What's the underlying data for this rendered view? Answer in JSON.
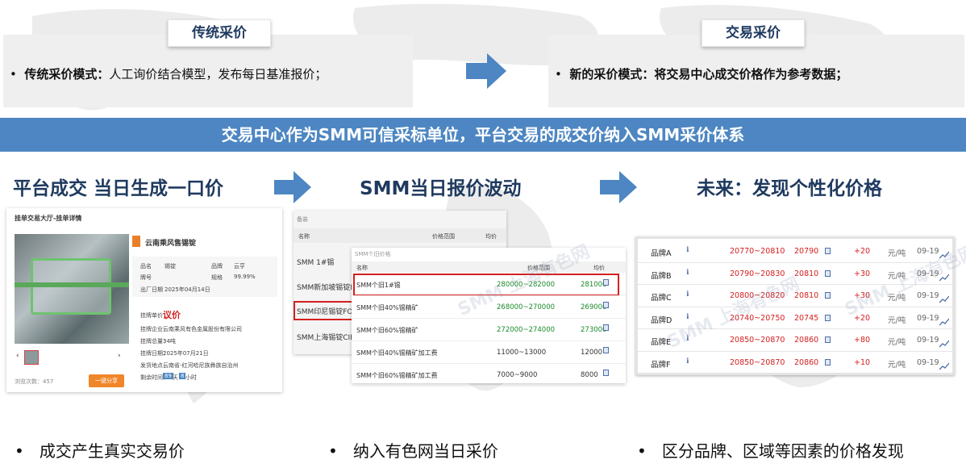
{
  "top_left": {
    "tag": "传统采价",
    "bullet_bold": "传统采价模式：",
    "bullet_text": "人工询价结合模型，发布每日基准报价；"
  },
  "top_right": {
    "tag": "交易采价",
    "bullet_bold": "新的采价模式：",
    "bullet_text": "将交易中心成交价格作为参考数据；"
  },
  "banner": "交易中心作为SMM可信采标单位，平台交易的成交价纳入SMM采价体系",
  "col1": {
    "heading": "平台成交 当日生成一口价",
    "footer": "成交产生真实交易价",
    "shot": {
      "title": "挂单交易大厅-挂单详情",
      "seller": "云南乘风售锡锭",
      "rows": [
        {
          "k1": "品名",
          "v1": "锡锭",
          "k2": "品牌",
          "v2": "云亨"
        },
        {
          "k1": "牌号",
          "v1": "",
          "k2": "规格",
          "v2": "99.99%"
        },
        {
          "k1": "出厂日期",
          "v1": "2025年04月14日",
          "k2": "",
          "v2": ""
        }
      ],
      "price_label": "挂牌单价：",
      "price_value": "议价",
      "info": [
        {
          "k": "挂牌企业：",
          "v": "云南乘风有色金属股份有限公司"
        },
        {
          "k": "挂牌总量：",
          "v": "34吨"
        },
        {
          "k": "挂牌日期：",
          "v": "2025年07月21日"
        },
        {
          "k": "发货地点：",
          "v": "云南省-红河哈尼族彝族自治州"
        },
        {
          "k": "剩余时间：",
          "v": "天 小时"
        }
      ],
      "days": "89",
      "hours": "8",
      "views": "浏览次数：457",
      "share_btn": "一键分享"
    }
  },
  "col2": {
    "heading": "SMM当日报价波动",
    "footer": "纳入有色网当日采价",
    "back": {
      "title": "备装",
      "h_name": "名称",
      "h_range": "价格范围",
      "h_avg": "均价",
      "rows": [
        "SMM 1#锡",
        "SMM新加坡锡锭FOB溢价",
        "SMM印尼锡锭FOB溢价",
        "SMM上海锡锭CIF溢价"
      ]
    },
    "front": {
      "title": "SMM个旧价格",
      "h_name": "名称",
      "h_range": "价格范围",
      "h_avg": "均价",
      "rows": [
        {
          "name": "SMM个旧1#锡",
          "range": "280000~282000",
          "avg": "281000",
          "color": "green"
        },
        {
          "name": "SMM个旧40%锡精矿",
          "range": "268000~270000",
          "avg": "269000",
          "color": "green"
        },
        {
          "name": "SMM个旧60%锡精矿",
          "range": "272000~274000",
          "avg": "273000",
          "color": "green"
        },
        {
          "name": "SMM个旧40%锡精矿加工费",
          "range": "11000~13000",
          "avg": "12000",
          "color": "black"
        },
        {
          "name": "SMM个旧60%锡精矿加工费",
          "range": "7000~9000",
          "avg": "8000",
          "color": "black"
        }
      ]
    }
  },
  "col3": {
    "heading": "未来：发现个性化价格",
    "footer": "区分品牌、区域等因素的价格发现",
    "rows": [
      {
        "brand": "品牌A",
        "range": "20770~20810",
        "avg": "20790",
        "chg": "+20",
        "unit": "元/吨",
        "date": "09-19"
      },
      {
        "brand": "品牌B",
        "range": "20790~20830",
        "avg": "20810",
        "chg": "+30",
        "unit": "元/吨",
        "date": "09-19"
      },
      {
        "brand": "品牌C",
        "range": "20800~20820",
        "avg": "20810",
        "chg": "+30",
        "unit": "元/吨",
        "date": "09-19"
      },
      {
        "brand": "品牌D",
        "range": "20740~20750",
        "avg": "20745",
        "chg": "+20",
        "unit": "元/吨",
        "date": "09-19"
      },
      {
        "brand": "品牌E",
        "range": "20850~20870",
        "avg": "20860",
        "chg": "+80",
        "unit": "元/吨",
        "date": "09-19"
      },
      {
        "brand": "品牌F",
        "range": "20850~20870",
        "avg": "20860",
        "chg": "+10",
        "unit": "元/吨",
        "date": "09-19"
      }
    ]
  },
  "watermark": "SMM 上海有色网",
  "colors": {
    "banner": "#4d86c2",
    "heading": "#1f3a5f",
    "arrow": "#4d86c2",
    "red": "#d42020",
    "green": "#1a8a2a"
  }
}
